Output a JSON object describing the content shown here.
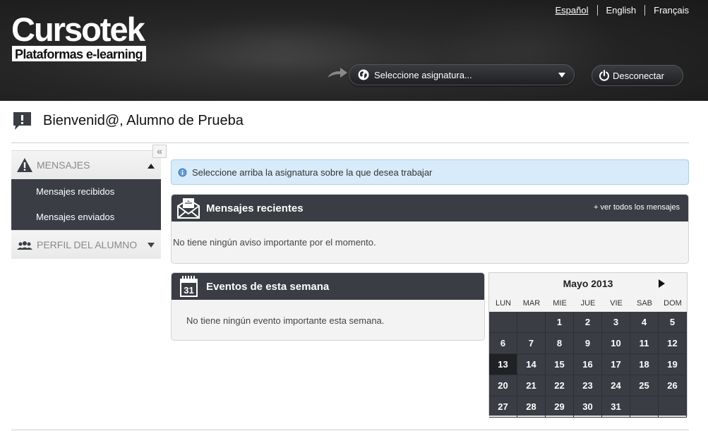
{
  "header": {
    "logo_main": "Cursotek",
    "logo_sub": "Plataformas e-learning",
    "languages": [
      "Español",
      "English",
      "Français"
    ],
    "subject_select": {
      "label": "Seleccione asignatura...",
      "icon": "globe-icon"
    },
    "logout_label": "Desconectar"
  },
  "welcome": {
    "title": "Bienvenid@, Alumno de Prueba",
    "icon": "speech-bubble-icon"
  },
  "sidebar": {
    "collapse_label": "«",
    "sections": [
      {
        "title": "MENSAJES",
        "icon": "warning-icon",
        "expanded": true,
        "items": [
          {
            "label": "Mensajes recibidos"
          },
          {
            "label": "Mensajes enviados"
          }
        ]
      },
      {
        "title": "PERFIL DEL ALUMNO",
        "icon": "group-icon",
        "expanded": false
      }
    ]
  },
  "info": {
    "text": "Seleccione arriba la asignatura sobre la que desea trabajar"
  },
  "messages_panel": {
    "title": "Mensajes recientes",
    "link": "+ ver todos los mensajes",
    "empty_text": "No tiene ningún aviso importante por el momento."
  },
  "events_panel": {
    "title": "Eventos de esta semana",
    "calendar_icon_day": "31",
    "empty_text": "No tiene ningún evento importante esta semana."
  },
  "calendar": {
    "month_label": "Mayo 2013",
    "weekdays": [
      "LUN",
      "MAR",
      "MIE",
      "JUE",
      "VIE",
      "SAB",
      "DOM"
    ],
    "days": [
      "",
      "",
      "1",
      "2",
      "3",
      "4",
      "5",
      "6",
      "7",
      "8",
      "9",
      "10",
      "11",
      "12",
      "13",
      "14",
      "15",
      "16",
      "17",
      "18",
      "19",
      "20",
      "21",
      "22",
      "23",
      "24",
      "25",
      "26",
      "27",
      "28",
      "29",
      "30",
      "31",
      "",
      ""
    ],
    "today": "13"
  },
  "colors": {
    "panel_header": "#3a3d44",
    "info_bg": "#d8ebfa",
    "header_bg": "#262626"
  }
}
